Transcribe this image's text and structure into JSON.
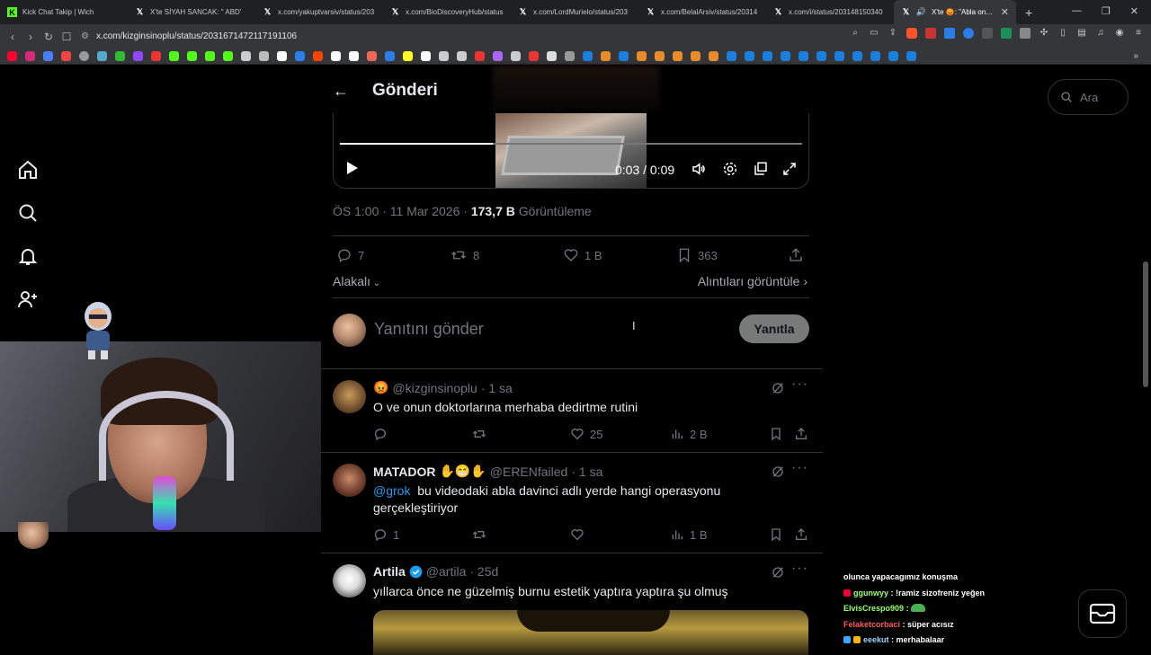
{
  "browser": {
    "tabs": [
      {
        "title": "Kick Chat Takip | Wich",
        "icon": "kick-icon",
        "active": false
      },
      {
        "title": "X'te SİYAH SANCAK: \" ABD'",
        "icon": "x-icon",
        "active": false
      },
      {
        "title": "x.com/yakuptvarsiv/status/203",
        "icon": "x-icon",
        "active": false
      },
      {
        "title": "x.com/BioDiscoveryHub/status",
        "icon": "x-icon",
        "active": false
      },
      {
        "title": "x.com/LordMurielo/status/203",
        "icon": "x-icon",
        "active": false
      },
      {
        "title": "x.com/BelalArsiv/status/20314",
        "icon": "x-icon",
        "active": false
      },
      {
        "title": "x.com/i/status/203148150340",
        "icon": "x-icon",
        "active": false
      },
      {
        "title": "X'te 😡: \"Abla onunla d",
        "icon": "x-icon",
        "active": true
      }
    ],
    "url": "x.com/kizginsinoplu/status/2031671472117191106"
  },
  "header": {
    "title": "Gönderi",
    "back_icon": "arrow-left-icon"
  },
  "search": {
    "placeholder": "Ara"
  },
  "video": {
    "current_time": "0:03",
    "separator": "/",
    "duration": "0:09",
    "progress_fraction": 0.33
  },
  "post_meta": {
    "time": "ÖS 1:00 · 11 Mar 2026 ·",
    "views_count": "173,7 B",
    "views_label": "Görüntüleme"
  },
  "post_actions": {
    "replies": "7",
    "reposts": "8",
    "likes": "1 B",
    "bookmarks": "363"
  },
  "related": {
    "label": "Alakalı",
    "quotes_label": "Alıntıları görüntüle"
  },
  "reply_composer": {
    "placeholder": "Yanıtını gönder",
    "button": "Yanıtla"
  },
  "replies": [
    {
      "name": "",
      "emoji": "😡",
      "handle": "@kizginsinoplu",
      "time": "· 1 sa",
      "text": "O ve onun doktorlarına merhaba dedirtme rutini",
      "mention": "",
      "reply_count": "",
      "likes": "25",
      "views": "2 B"
    },
    {
      "name": "MATADOR",
      "emoji": "✋😁✋",
      "handle": "@ERENfailed",
      "time": "· 1 sa",
      "mention": "@grok",
      "text": "bu videodaki abla davinci adlı yerde hangi operasyonu gerçekleştiriyor",
      "reply_count": "1",
      "likes": "",
      "views": "1 B"
    },
    {
      "name": "Artila",
      "emoji": "",
      "handle": "@artila",
      "time": "· 25d",
      "text": "yıllarca önce ne güzelmiş burnu estetik yaptıra yaptıra şu olmuş",
      "mention": "",
      "verified": true
    }
  ],
  "chat": [
    {
      "user": "",
      "message": "olunca yapacagımız konuşma",
      "color": "#ffffff"
    },
    {
      "user": "ggunwyy",
      "message": ": !ramiz sizofreniz yeğen",
      "color": "#9cff6b"
    },
    {
      "user": "ElvisCrespo909",
      "message": ":",
      "color": "#9cff6b"
    },
    {
      "user": "Felaketcorbaci",
      "message": ": süper acısız",
      "color": "#ff5a5a"
    },
    {
      "user": "eeekut",
      "message": ": merhabalaar",
      "color": "#9fd3ff"
    }
  ],
  "colors": {
    "accent": "#1d9bf0",
    "background": "#000000",
    "muted": "#71767b",
    "border": "#2f3336"
  }
}
